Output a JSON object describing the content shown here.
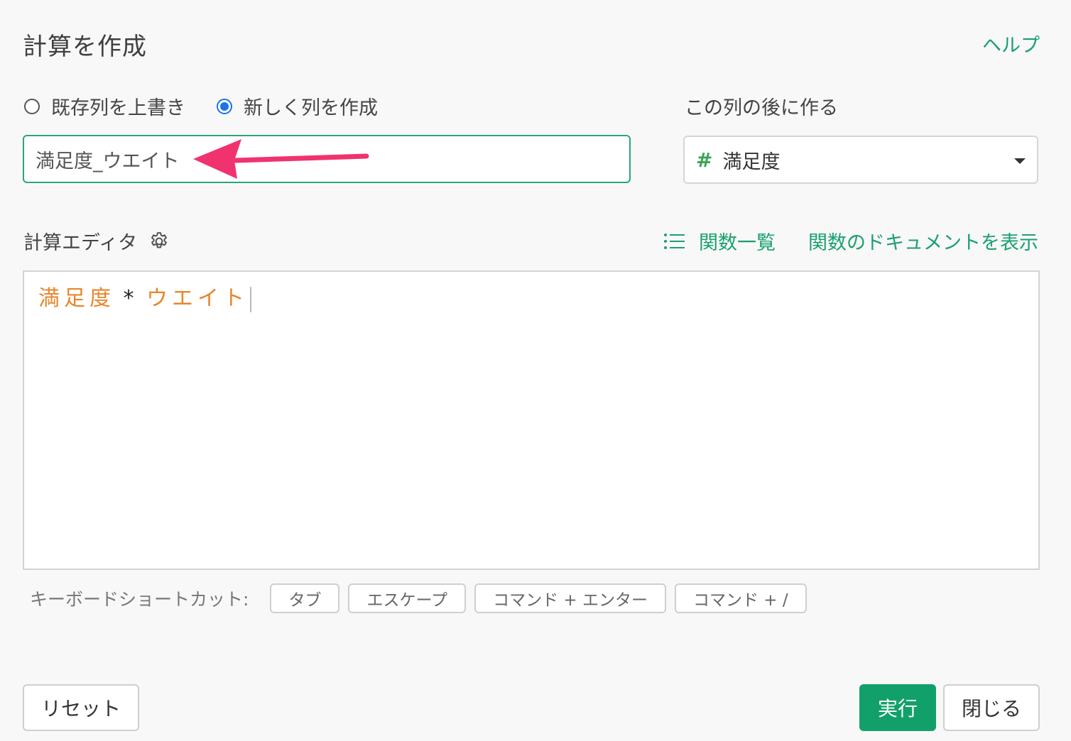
{
  "dialog": {
    "title": "計算を作成",
    "help_link": "ヘルプ"
  },
  "mode": {
    "options": [
      {
        "label": "既存列を上書き",
        "checked": false
      },
      {
        "label": "新しく列を作成",
        "checked": true
      }
    ]
  },
  "column_name": {
    "value": "満足度_ウエイト"
  },
  "position": {
    "label": "この列の後に作る",
    "selected_icon": "hash-icon",
    "selected_value": "満足度"
  },
  "editor": {
    "label": "計算エディタ",
    "function_list": "関数一覧",
    "function_docs": "関数のドキュメントを表示",
    "tokens": {
      "col1": "満足度",
      "operator": "*",
      "col2": "ウエイト"
    }
  },
  "shortcuts": {
    "label": "キーボードショートカット:",
    "keys": [
      "タブ",
      "エスケープ",
      "コマンド + エンター",
      "コマンド + /"
    ]
  },
  "buttons": {
    "reset": "リセット",
    "run": "実行",
    "close": "閉じる"
  },
  "colors": {
    "accent": "#1aa06d",
    "run_button": "#12a06a",
    "radio_checked": "#1a73e8",
    "column_token": "#e8862a",
    "arrow": "#f0336f"
  }
}
